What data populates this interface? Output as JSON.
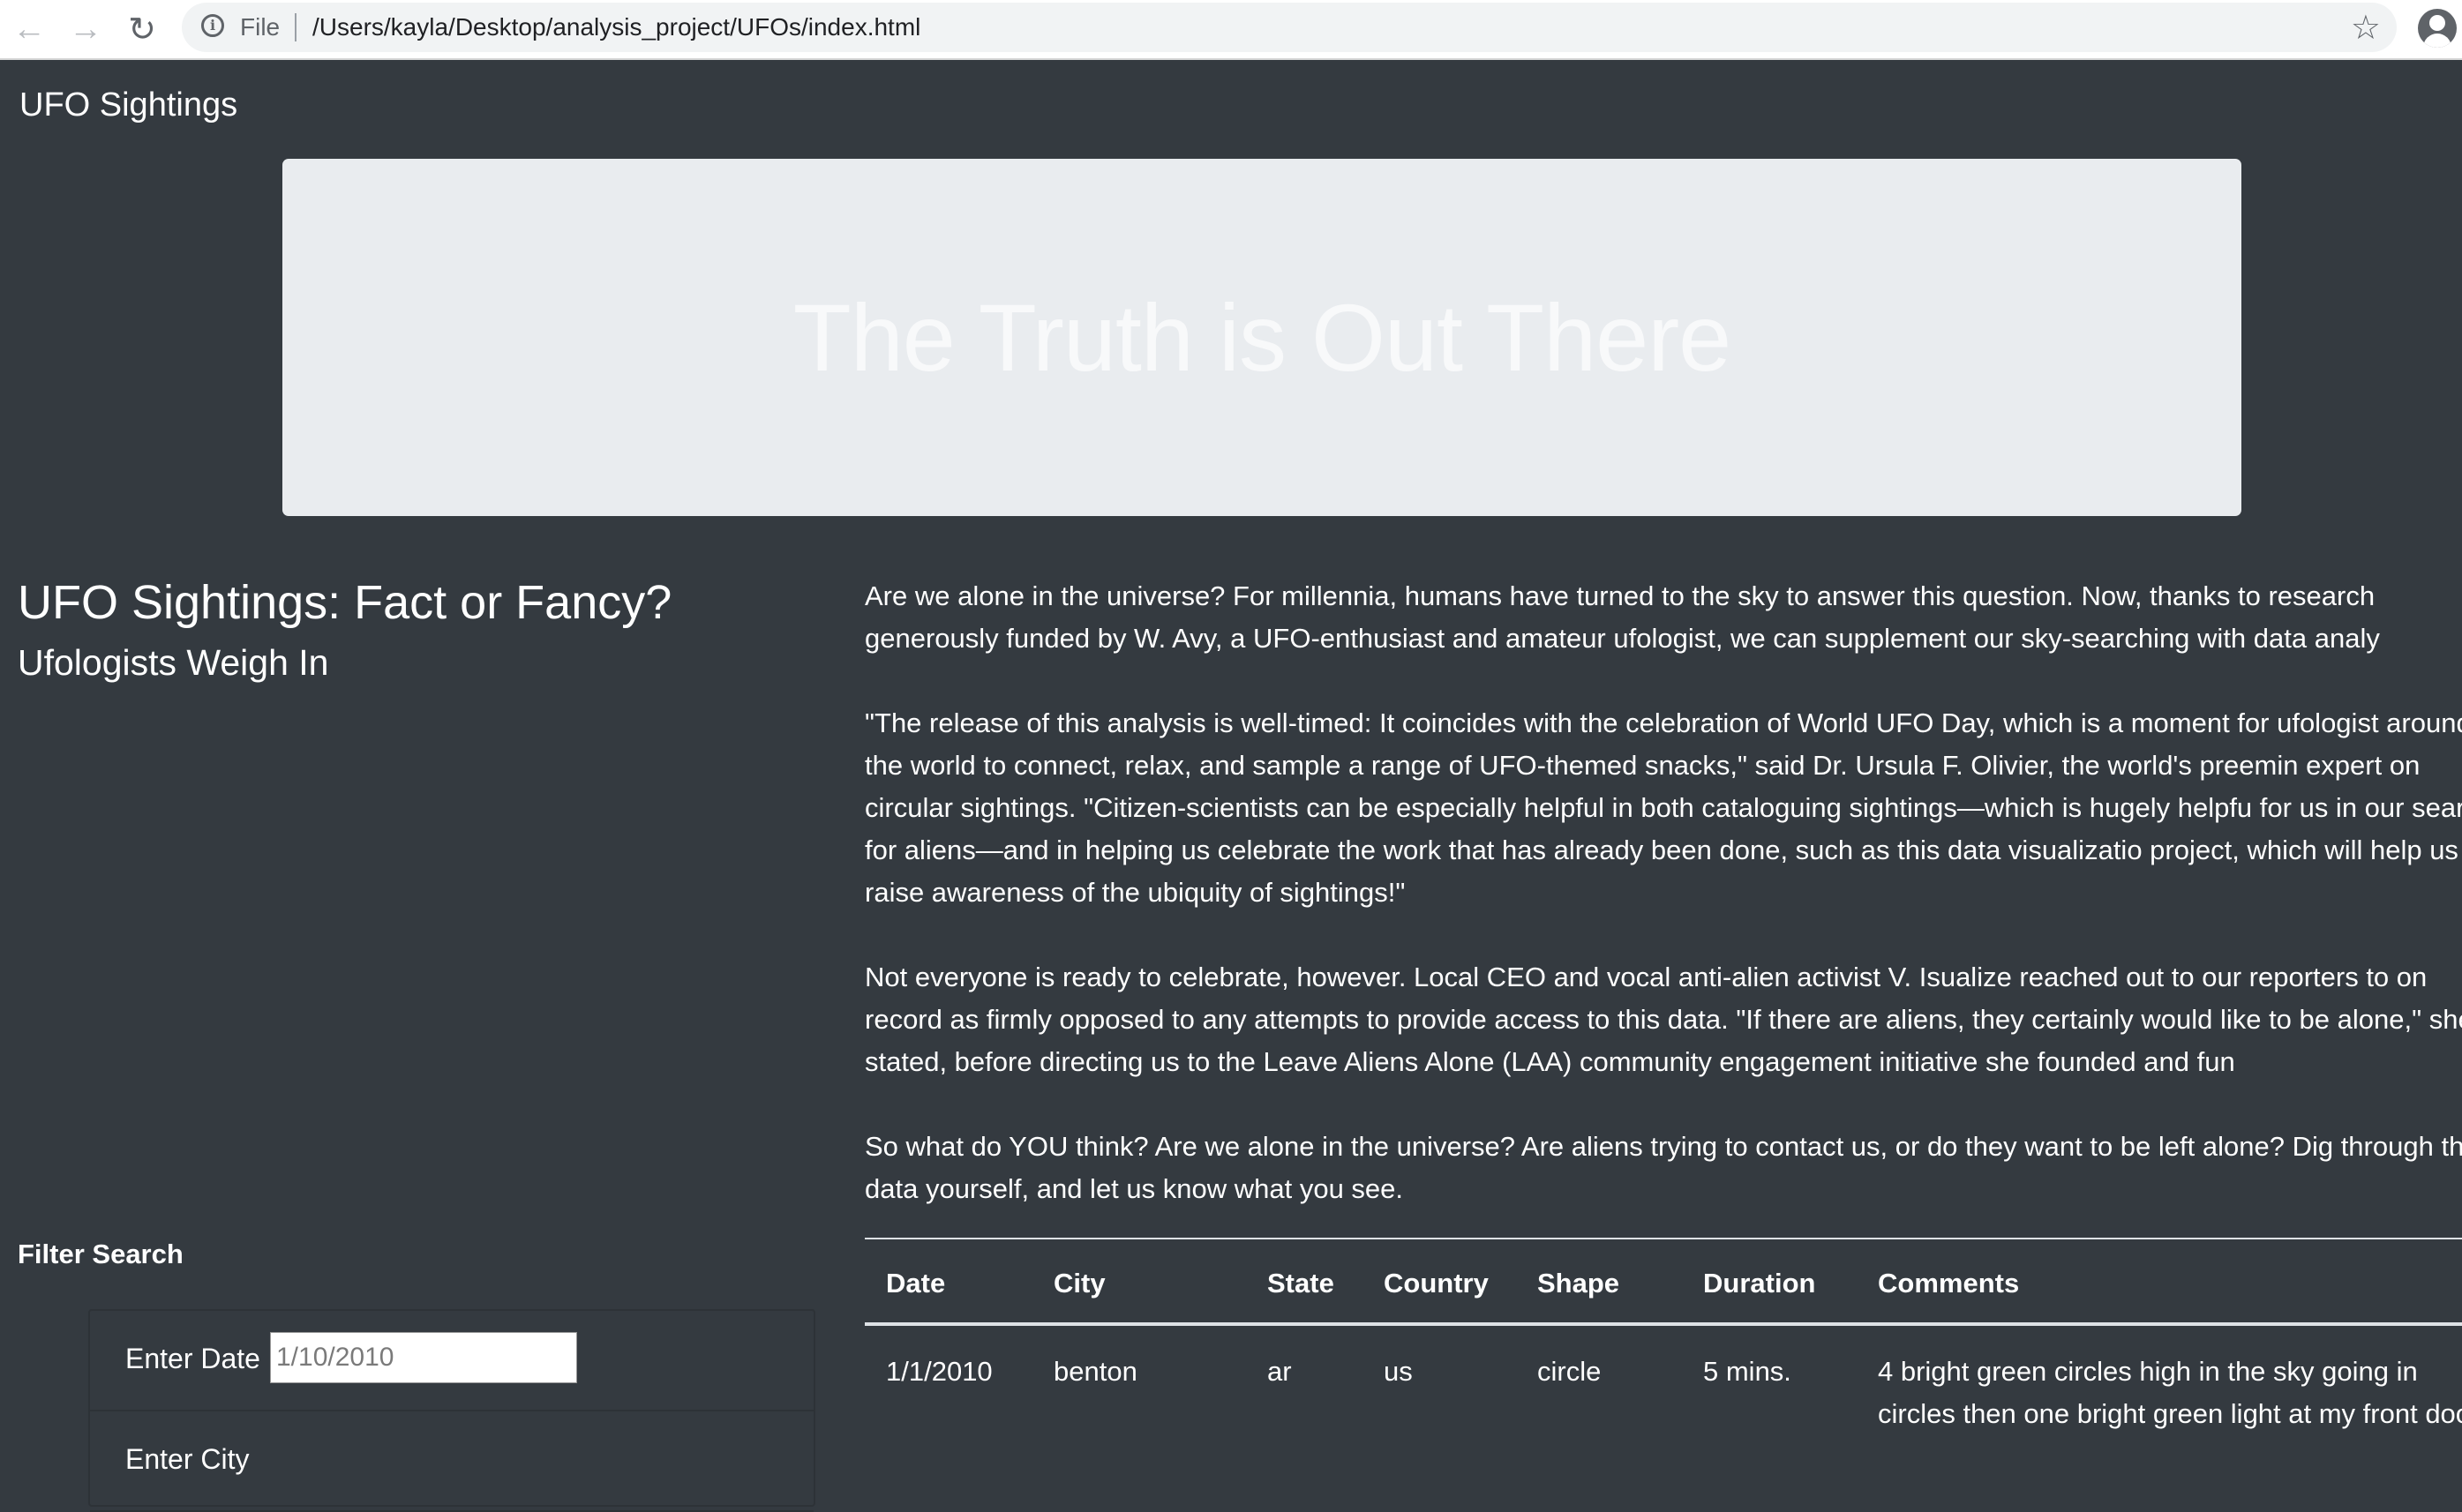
{
  "browser": {
    "file_label": "File",
    "url": "/Users/kayla/Desktop/analysis_project/UFOs/index.html"
  },
  "navbar": {
    "brand": "UFO Sightings"
  },
  "jumbotron": {
    "title": "The Truth is Out There"
  },
  "header": {
    "title": "UFO Sightings: Fact or Fancy?",
    "subtitle": "Ufologists Weigh In"
  },
  "article": {
    "paragraphs": [
      "Are we alone in the universe? For millennia, humans have turned to the sky to answer this question. Now, thanks to research generously funded by W. Avy, a UFO-enthusiast and amateur ufologist, we can supplement our sky-searching with data analy",
      "\"The release of this analysis is well-timed: It coincides with the celebration of World UFO Day, which is a moment for ufologist around the world to connect, relax, and sample a range of UFO-themed snacks,\" said Dr. Ursula F. Olivier, the world's preemin expert on circular sightings. \"Citizen-scientists can be especially helpful in both cataloguing sightings—which is hugely helpfu for us in our search for aliens—and in helping us celebrate the work that has already been done, such as this data visualizatio project, which will help us raise awareness of the ubiquity of sightings!\"",
      "Not everyone is ready to celebrate, however. Local CEO and vocal anti-alien activist V. Isualize reached out to our reporters to on record as firmly opposed to any attempts to provide access to this data. \"If there are aliens, they certainly would like to be alone,\" she stated, before directing us to the Leave Aliens Alone (LAA) community engagement initiative she founded and fun",
      "So what do YOU think? Are we alone in the universe? Are aliens trying to contact us, or do they want to be left alone? Dig through the data yourself, and let us know what you see."
    ]
  },
  "filters": {
    "title": "Filter Search",
    "date_label": "Enter Date",
    "date_placeholder": "1/10/2010",
    "city_label": "Enter City"
  },
  "table": {
    "headers": [
      "Date",
      "City",
      "State",
      "Country",
      "Shape",
      "Duration",
      "Comments"
    ],
    "rows": [
      {
        "date": "1/1/2010",
        "city": "benton",
        "state": "ar",
        "country": "us",
        "shape": "circle",
        "duration": "5 mins.",
        "comments": "4 bright green circles high in the sky going in circles then one bright green light at my front door."
      }
    ]
  }
}
